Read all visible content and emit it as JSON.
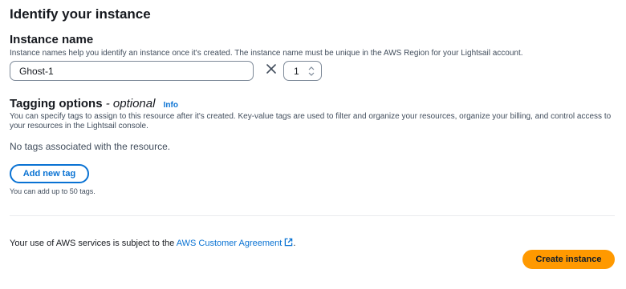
{
  "section": {
    "title": "Identify your instance"
  },
  "instance_name": {
    "label": "Instance name",
    "description": "Instance names help you identify an instance once it's created. The instance name must be unique in the AWS Region for your Lightsail account.",
    "value": "Ghost-1",
    "quantity": "1",
    "multiply_icon": "close-x-icon",
    "stepper_icon": "up-down-arrows-icon"
  },
  "tagging": {
    "title": "Tagging options",
    "separator": " - ",
    "optional": "optional",
    "info_link": "Info",
    "description": "You can specify tags to assign to this resource after it's created. Key-value tags are used to filter and organize your resources, organize your billing, and control access to your resources in the Lightsail console.",
    "empty_state": "No tags associated with the resource.",
    "add_button": "Add new tag",
    "limit_hint": "You can add up to 50 tags."
  },
  "footer": {
    "agreement_prefix": "Your use of AWS services is subject to the ",
    "agreement_link": "AWS Customer Agreement",
    "agreement_suffix": ".",
    "external_icon": "external-link-icon",
    "create_button": "Create instance"
  },
  "colors": {
    "link": "#0972d3",
    "primary_button": "#ff9900",
    "border": "#7d8998",
    "divider": "#e9ebed"
  }
}
